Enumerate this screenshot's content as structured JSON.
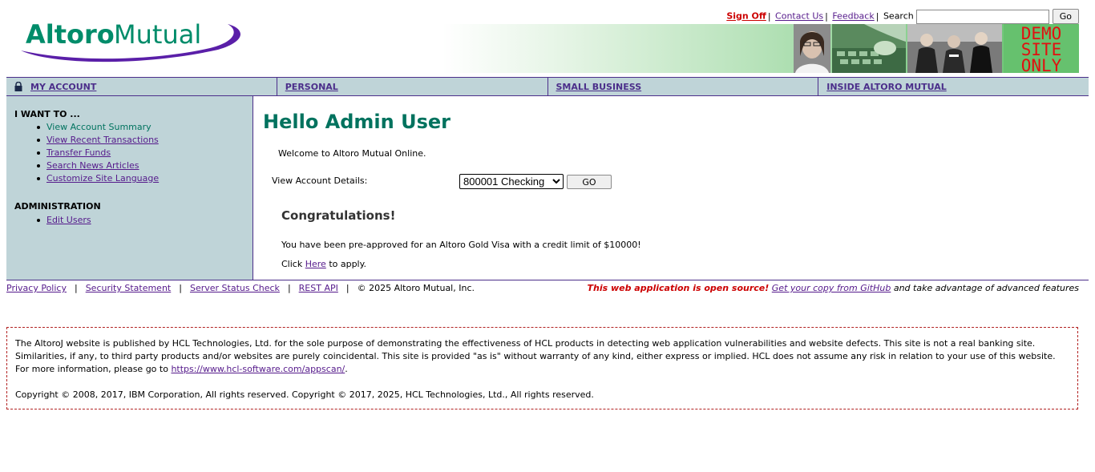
{
  "brand": {
    "logo_part1": "Altoro",
    "logo_part2": "Mutual",
    "logo_color": "#008c6a",
    "swoosh_color": "#5a1fa8",
    "demo_badge": [
      "DEMO",
      "SITE",
      "ONLY"
    ]
  },
  "header": {
    "sign_off": "Sign Off",
    "contact_us": "Contact Us",
    "feedback": "Feedback",
    "search_label": "Search",
    "search_value": "",
    "search_go": "Go"
  },
  "tabs": [
    {
      "label": "MY ACCOUNT"
    },
    {
      "label": "PERSONAL"
    },
    {
      "label": "SMALL BUSINESS"
    },
    {
      "label": "INSIDE ALTORO MUTUAL"
    }
  ],
  "sidebar": {
    "i_want_to_heading": "I WANT TO ...",
    "i_want_to_items": [
      {
        "label": "View Account Summary"
      },
      {
        "label": "View Recent Transactions"
      },
      {
        "label": "Transfer Funds"
      },
      {
        "label": "Search News Articles"
      },
      {
        "label": "Customize Site Language"
      }
    ],
    "admin_heading": "ADMINISTRATION",
    "admin_items": [
      {
        "label": "Edit Users"
      }
    ]
  },
  "main": {
    "greeting": "Hello Admin User",
    "welcome": "Welcome to Altoro Mutual Online.",
    "view_details_label": "View Account Details:",
    "account_selected": "800001 Checking",
    "go_button": "GO",
    "congrats_heading": "Congratulations!",
    "preapproved_text": "You have been pre-approved for an Altoro Gold Visa with a credit limit of $10000!",
    "click_prefix": "Click",
    "here_link": "Here",
    "click_suffix": "to apply."
  },
  "footer": {
    "privacy": "Privacy Policy",
    "security": "Security Statement",
    "server_status": "Server Status Check",
    "rest_api": "REST API",
    "copyright_short": "© 2025 Altoro Mutual, Inc.",
    "open_source_notice": "This web application is open source!",
    "github_link": "Get your copy from GitHub",
    "advanced_features": "and take advantage of advanced features"
  },
  "disclaimer": {
    "body": "The AltoroJ website is published by HCL Technologies, Ltd. for the sole purpose of demonstrating the effectiveness of HCL products in detecting web application vulnerabilities and website defects. This site is not a real banking site. Similarities, if any, to third party products and/or websites are purely coincidental. This site is provided \"as is\" without warranty of any kind, either express or implied. HCL does not assume any risk in relation to your use of this website. For more information, please go to",
    "link": "https://www.hcl-software.com/appscan/",
    "link_suffix": ".",
    "copyright": "Copyright © 2008, 2017, IBM Corporation, All rights reserved. Copyright © 2017, 2025, HCL Technologies, Ltd., All rights reserved."
  }
}
